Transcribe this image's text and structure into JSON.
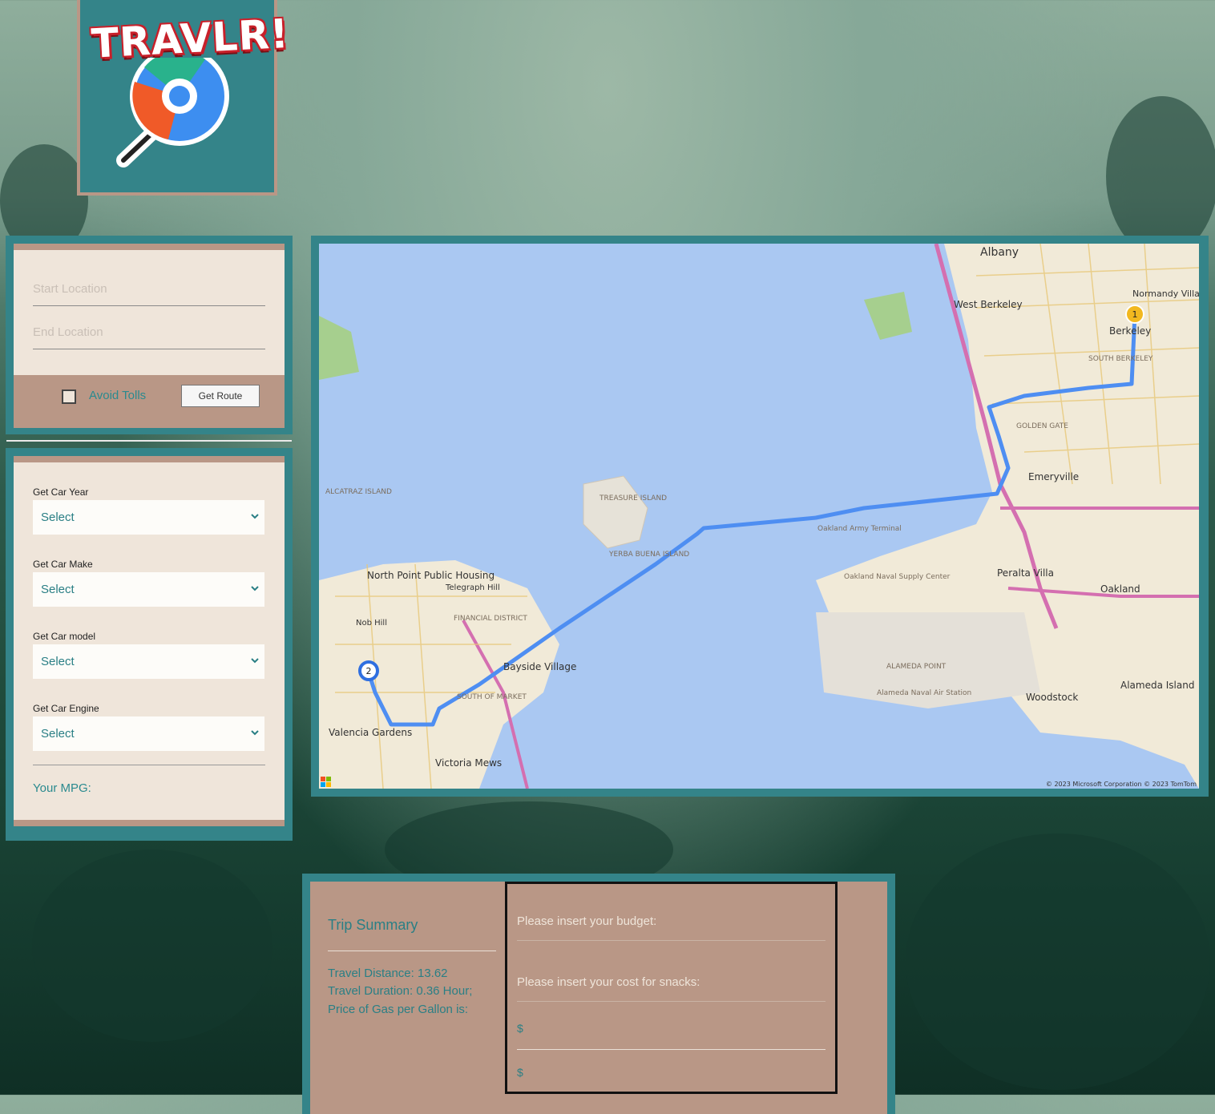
{
  "logo": {
    "text": "TRAVLR!"
  },
  "route_form": {
    "start_placeholder": "Start Location",
    "end_placeholder": "End Location",
    "avoid_tolls_label": "Avoid Tolls",
    "get_route_label": "Get Route"
  },
  "car_form": {
    "year_label": "Get Car Year",
    "make_label": "Get Car Make",
    "model_label": "Get Car model",
    "engine_label": "Get Car Engine",
    "select_value": "Select",
    "mpg_label": "Your MPG:"
  },
  "map": {
    "labels": [
      "Albany",
      "West Berkeley",
      "Berkeley",
      "Emeryville",
      "Oakland",
      "Peralta Villa",
      "Alameda Island",
      "Woodstock",
      "North Point Public Housing",
      "Bayside Village",
      "Valencia Gardens",
      "Victoria Mews",
      "TREASURE ISLAND",
      "YERBA BUENA ISLAND",
      "ALCATRAZ ISLAND",
      "Oakland Army Terminal",
      "Oakland Naval Supply Center",
      "ALAMEDA POINT",
      "Alameda Naval Air Station",
      "Normandy Village",
      "SOUTH BERKELEY",
      "GOLDEN GATE",
      "FINANCIAL DISTRICT",
      "SOUTH OF MARKET",
      "Nob Hill",
      "Telegraph Hill"
    ],
    "marker_start": "1",
    "marker_end": "2",
    "copyright": "© 2023 Microsoft Corporation © 2023 TomTom"
  },
  "trip": {
    "title": "Trip Summary",
    "distance": "Travel Distance: 13.62",
    "duration": "Travel Duration: 0.36 Hour;",
    "gas_price": "Price of Gas per Gallon is:",
    "budget_label": "Please insert your budget:",
    "snacks_label": "Please insert your cost for snacks:",
    "currency_1": "$",
    "currency_2": "$"
  },
  "colors": {
    "teal": "#348489",
    "tan": "#b99786",
    "cream": "#efe5da",
    "route_blue": "#3b82f6"
  }
}
